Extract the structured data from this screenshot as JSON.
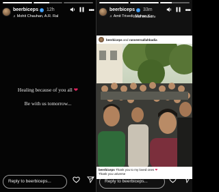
{
  "left_story": {
    "progress": [
      1.0,
      0.55,
      0.0
    ],
    "username": "beerbiceps",
    "time": "12h",
    "music": "Mohit Chauhan, A.R. Ral",
    "line1": "Healing because of you all",
    "line2": "Be with us tomorrow...",
    "reply_placeholder": "Reply to beerbiceps..."
  },
  "right_story": {
    "progress": [
      1.0,
      1.0,
      0.4
    ],
    "username": "beerbiceps",
    "time": "33m",
    "music": "Amit Trivedi, Mohan Kar",
    "caption": "Real treasure",
    "tag_user1": "beerbiceps",
    "tag_and": "and",
    "tag_user2": "ranveersallahbadia",
    "comment_user": "beerbiceps",
    "comment_text": "Thank you to my loved ones",
    "comment_text2": "Thank you universe",
    "reply_placeholder": "Reply to beerbiceps..."
  },
  "icons": {
    "music": "music-note-icon",
    "sound": "speaker-icon",
    "pause": "pause-icon",
    "more": "more-icon",
    "like": "heart-icon",
    "share": "send-icon"
  },
  "colors": {
    "verified": "#3897f0",
    "heart": "#e0245e"
  }
}
